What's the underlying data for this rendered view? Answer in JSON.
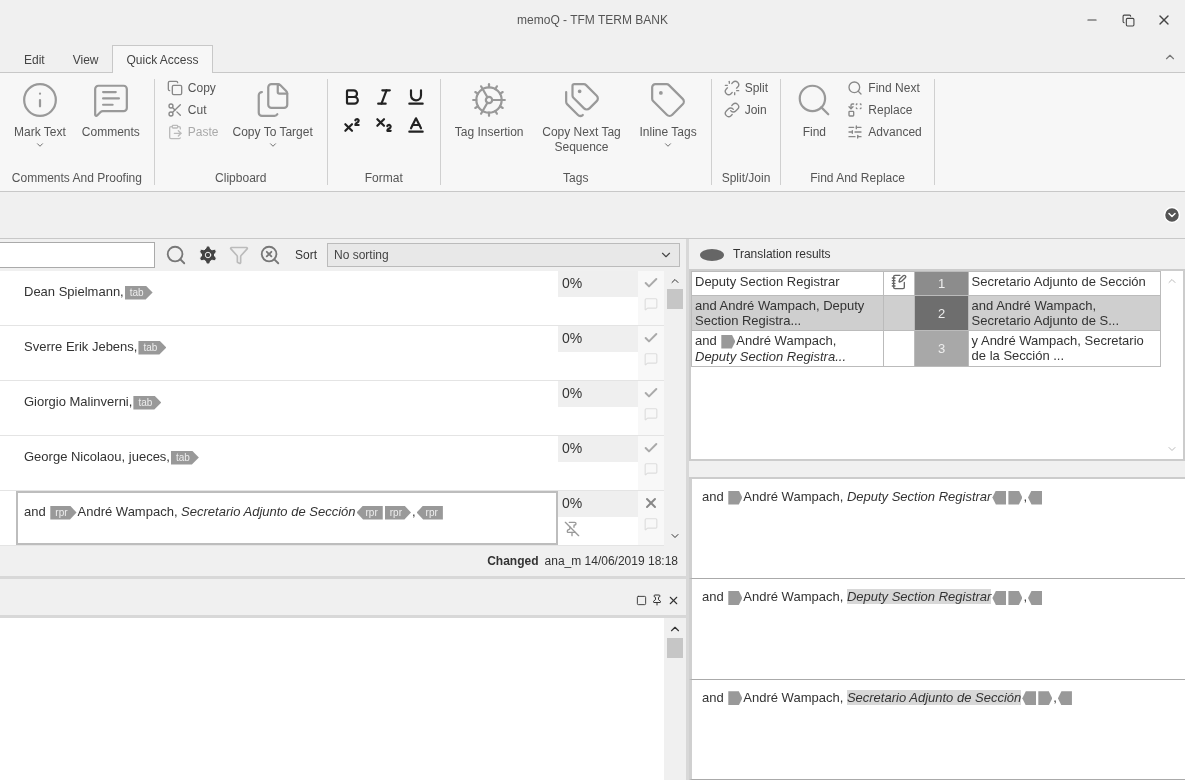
{
  "window": {
    "title": "memoQ - TFM TERM BANK"
  },
  "ribbon": {
    "tabs": [
      {
        "label": "Edit",
        "selected": false
      },
      {
        "label": "View",
        "selected": false
      },
      {
        "label": "Quick Access",
        "selected": true
      }
    ],
    "groups": [
      {
        "label": "Comments And Proofing",
        "kind": "buttons",
        "items": [
          {
            "label": "Mark Text",
            "kind": "large",
            "dropdown": true
          },
          {
            "label": "Comments",
            "kind": "large",
            "dropdown": false
          }
        ]
      },
      {
        "label": "Clipboard",
        "kind": "buttons",
        "items": [
          {
            "label": "Copy",
            "kind": "small",
            "disabled": false
          },
          {
            "label": "Cut",
            "kind": "small",
            "disabled": false
          },
          {
            "label": "Paste",
            "kind": "small",
            "disabled": true
          },
          {
            "label": "Copy To Target",
            "kind": "large",
            "dropdown": true
          }
        ]
      },
      {
        "label": "Format",
        "kind": "format"
      },
      {
        "label": "Tags",
        "kind": "buttons",
        "items": [
          {
            "label": "Tag Insertion",
            "kind": "large",
            "dropdown": false
          },
          {
            "label": "Copy Next Tag Sequence",
            "kind": "large",
            "dropdown": false
          },
          {
            "label": "Inline Tags",
            "kind": "large",
            "dropdown": true
          }
        ]
      },
      {
        "label": "Split/Join",
        "kind": "buttons",
        "items": [
          {
            "label": "Split",
            "kind": "small",
            "disabled": false
          },
          {
            "label": "Join",
            "kind": "small",
            "disabled": false
          }
        ]
      },
      {
        "label": "Find And Replace",
        "kind": "buttons",
        "items": [
          {
            "label": "Find",
            "kind": "large",
            "dropdown": false
          },
          {
            "label": "Find Next",
            "kind": "small",
            "disabled": false
          },
          {
            "label": "Replace",
            "kind": "small",
            "disabled": false
          },
          {
            "label": "Advanced",
            "kind": "small",
            "disabled": false
          }
        ]
      }
    ]
  },
  "editor": {
    "sort_label": "Sort",
    "sort_value": "No sorting",
    "segments": [
      {
        "parts": [
          {
            "kind": "text",
            "text": "Dean Spielmann,"
          },
          {
            "kind": "tag",
            "label": "tab",
            "closing": false
          }
        ],
        "match": "0%",
        "confirmed": true,
        "pinned": false,
        "selected": false
      },
      {
        "parts": [
          {
            "kind": "text",
            "text": "Sverre Erik Jebens,"
          },
          {
            "kind": "tag",
            "label": "tab",
            "closing": false
          }
        ],
        "match": "0%",
        "confirmed": true,
        "pinned": false,
        "selected": false
      },
      {
        "parts": [
          {
            "kind": "text",
            "text": "Giorgio Malinverni,"
          },
          {
            "kind": "tag",
            "label": "tab",
            "closing": false
          }
        ],
        "match": "0%",
        "confirmed": true,
        "pinned": false,
        "selected": false
      },
      {
        "parts": [
          {
            "kind": "text",
            "text": "George Nicolaou, jueces,"
          },
          {
            "kind": "tag",
            "label": "tab",
            "closing": false
          }
        ],
        "match": "0%",
        "confirmed": true,
        "pinned": false,
        "selected": false
      },
      {
        "parts": [
          {
            "kind": "text",
            "text": "and "
          },
          {
            "kind": "tag",
            "label": "rpr",
            "closing": false
          },
          {
            "kind": "text",
            "text": "André Wampach, "
          },
          {
            "kind": "italic",
            "text": "Secretario Adjunto de Sección"
          },
          {
            "kind": "tag",
            "label": "rpr",
            "closing": true
          },
          {
            "kind": "tag",
            "label": "rpr",
            "closing": false
          },
          {
            "kind": "text",
            "text": ","
          },
          {
            "kind": "tag",
            "label": "rpr",
            "closing": true
          }
        ],
        "match": "0%",
        "confirmed": false,
        "pinned": true,
        "selected": true
      }
    ],
    "status": {
      "label": "Changed",
      "detail": "ana_m 14/06/2019 18:18"
    }
  },
  "results": {
    "title": "Translation results",
    "rows": [
      {
        "source": [
          {
            "kind": "text",
            "text": "Deputy Section Registrar"
          }
        ],
        "note": true,
        "number": "1",
        "color": "#8c8c8c",
        "target": "Secretario Adjunto de Sección",
        "selected": false
      },
      {
        "source": [
          {
            "kind": "text",
            "text": "and André Wampach, Deputy Section Registra..."
          }
        ],
        "note": false,
        "number": "2",
        "color": "#6e6e6e",
        "target": "and André Wampach, Secretario Adjunto de S...",
        "selected": true
      },
      {
        "source": [
          {
            "kind": "text",
            "text": "and "
          },
          {
            "kind": "tag",
            "closing": false
          },
          {
            "kind": "text",
            "text": "André Wampach, "
          },
          {
            "kind": "italic",
            "text": "Deputy Section Registra..."
          }
        ],
        "note": false,
        "number": "3",
        "color": "#a8a8a8",
        "target": "y André Wampach, Secretario de la Sección ...",
        "selected": false
      }
    ]
  },
  "previews": [
    {
      "parts": [
        {
          "kind": "text",
          "text": "and "
        },
        {
          "kind": "tag",
          "closing": false
        },
        {
          "kind": "text",
          "text": "André Wampach, "
        },
        {
          "kind": "italic",
          "text": "Deputy Section Registrar"
        },
        {
          "kind": "tag",
          "closing": true
        },
        {
          "kind": "tag",
          "closing": false
        },
        {
          "kind": "text",
          "text": ","
        },
        {
          "kind": "tag",
          "closing": true
        }
      ]
    },
    {
      "parts": [
        {
          "kind": "text",
          "text": "and "
        },
        {
          "kind": "tag",
          "closing": false
        },
        {
          "kind": "text",
          "text": "André Wampach, "
        },
        {
          "kind": "mark",
          "text": "Deputy Section Registrar"
        },
        {
          "kind": "tag",
          "closing": true
        },
        {
          "kind": "tag",
          "closing": false
        },
        {
          "kind": "text",
          "text": ","
        },
        {
          "kind": "tag",
          "closing": true
        }
      ]
    },
    {
      "parts": [
        {
          "kind": "text",
          "text": "and "
        },
        {
          "kind": "tag",
          "closing": false
        },
        {
          "kind": "text",
          "text": "André Wampach, "
        },
        {
          "kind": "mark",
          "text": "Secretario Adjunto de Sección"
        },
        {
          "kind": "tag",
          "closing": true
        },
        {
          "kind": "tag",
          "closing": false
        },
        {
          "kind": "text",
          "text": ","
        },
        {
          "kind": "tag",
          "closing": true
        }
      ]
    }
  ]
}
